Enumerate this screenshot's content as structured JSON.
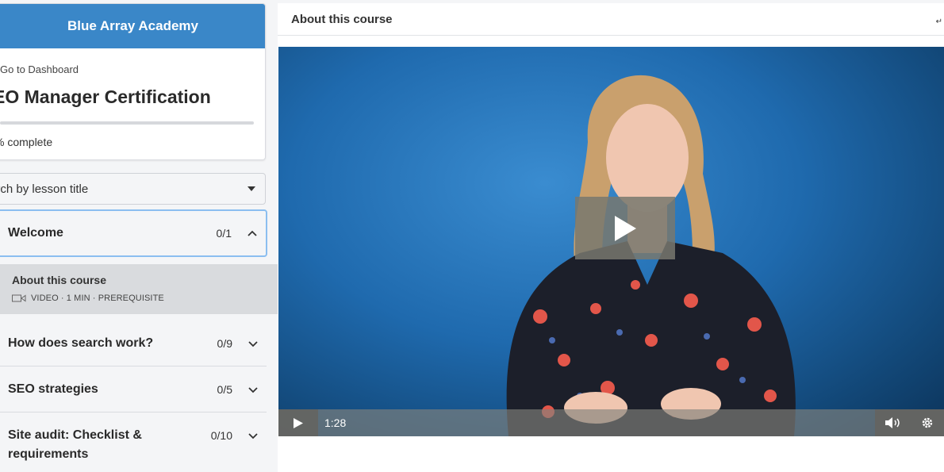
{
  "sidebar": {
    "brand": "Blue Array Academy",
    "dashboard_link": "Go to Dashboard",
    "course_title": "EO Manager Certification",
    "progress": {
      "percent_complete": 0,
      "label": "% complete"
    },
    "search": {
      "placeholder": "arch by lesson title"
    },
    "sections": [
      {
        "title": "Welcome",
        "count": "0/1",
        "open": true
      },
      {
        "title": "How does search work?",
        "count": "0/9",
        "open": false
      },
      {
        "title": "SEO strategies",
        "count": "0/5",
        "open": false
      },
      {
        "title": "Site audit: Checklist & requirements",
        "count": "0/10",
        "open": false
      }
    ],
    "active_lesson": {
      "title": "About this course",
      "meta": "VIDEO · 1 MIN · PREREQUISITE",
      "icon": "video-camera-icon"
    }
  },
  "main": {
    "title": "About this course",
    "player": {
      "time": "1:28"
    }
  },
  "colors": {
    "brand": "#3a87c8",
    "focus_border": "#8bbef0",
    "active_lesson_bg": "#d9dbde"
  }
}
